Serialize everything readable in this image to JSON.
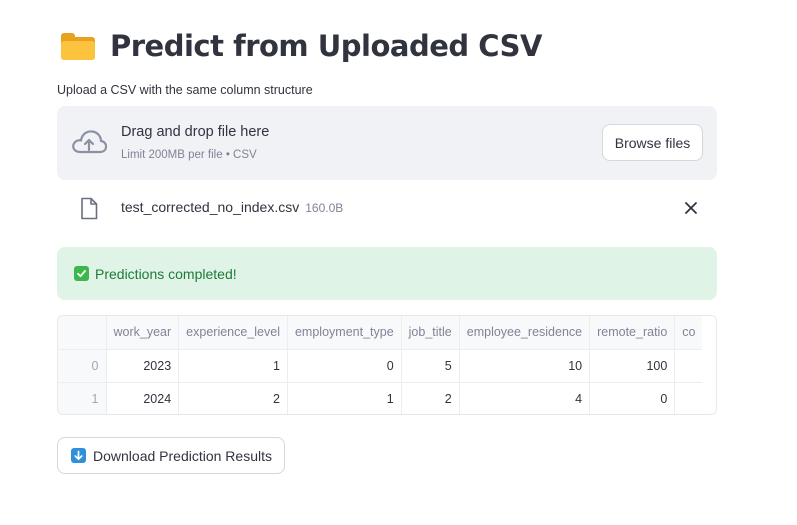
{
  "page": {
    "title": "Predict from Uploaded CSV",
    "title_icon": "folder-icon"
  },
  "uploader": {
    "label": "Upload a CSV with the same column structure",
    "drop_title": "Drag and drop file here",
    "drop_limit": "Limit 200MB per file • CSV",
    "browse_label": "Browse files",
    "icon": "cloud-upload-icon"
  },
  "uploaded_file": {
    "name": "test_corrected_no_index.csv",
    "size": "160.0B",
    "icon": "file-icon",
    "remove_icon": "close-icon"
  },
  "status": {
    "message": "Predictions completed!",
    "icon": "check-icon",
    "color": "#3db64c"
  },
  "table": {
    "columns": [
      "",
      "work_year",
      "experience_level",
      "employment_type",
      "job_title",
      "employee_residence",
      "remote_ratio",
      "co"
    ],
    "rows": [
      [
        "0",
        "2023",
        "1",
        "0",
        "5",
        "10",
        "100",
        ""
      ],
      [
        "1",
        "2024",
        "2",
        "1",
        "2",
        "4",
        "0",
        ""
      ]
    ]
  },
  "download": {
    "label": "Download Prediction Results",
    "icon": "down-arrow-icon",
    "icon_color": "#2f8fd8"
  }
}
